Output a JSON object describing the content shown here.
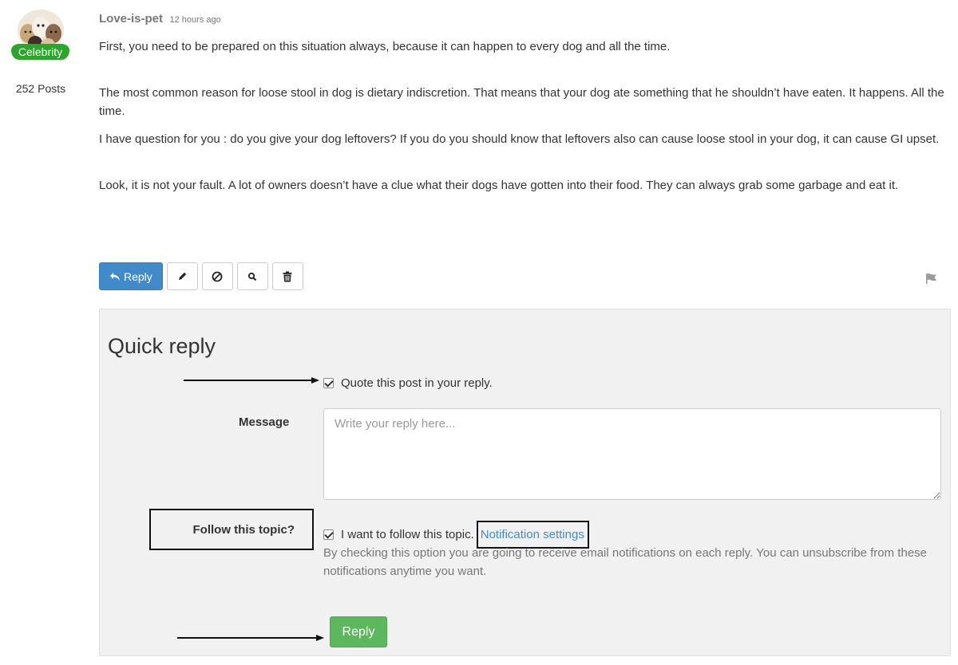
{
  "author": {
    "username": "Love-is-pet",
    "badge": "Celebrity",
    "post_count": "252 Posts",
    "avatar_icon": "dogs-group-avatar"
  },
  "post": {
    "timestamp": "12 hours ago",
    "paragraphs": [
      "First, you need to be prepared on this situation always, because it can happen to every dog and all the time.",
      "The most common reason for loose stool in dog is dietary indiscretion. That means that your dog ate something that he shouldn’t have eaten. It happens. All the time.",
      "I have question for you : do you give your dog leftovers? If you do you should know that leftovers also can cause loose stool in your dog, it can cause GI upset.",
      "Look, it is not your fault. A lot of owners doesn’t have a clue what their dogs have gotten into their food. They can always grab some garbage and eat it."
    ]
  },
  "actions": {
    "reply_label": "Reply",
    "icons": [
      "pencil-icon",
      "block-icon",
      "search-icon",
      "trash-icon"
    ],
    "flag_icon": "flag-icon"
  },
  "quick_reply": {
    "title": "Quick reply",
    "quote_label": "Quote this post in your reply.",
    "quote_checked": true,
    "message_label": "Message",
    "message_placeholder": "Write your reply here...",
    "message_value": "",
    "follow_label": "Follow this topic?",
    "follow_checked": true,
    "follow_text": "I want to follow this topic.",
    "notification_link": "Notification settings",
    "follow_help": "By checking this option you are going to receive email notifications on each reply. You can unsubscribe from these notifications anytime you want.",
    "submit_label": "Reply"
  },
  "colors": {
    "primary": "#428bca",
    "success": "#5cb85c",
    "badge": "#2aa62a",
    "panel_bg": "#f1f1f1"
  }
}
